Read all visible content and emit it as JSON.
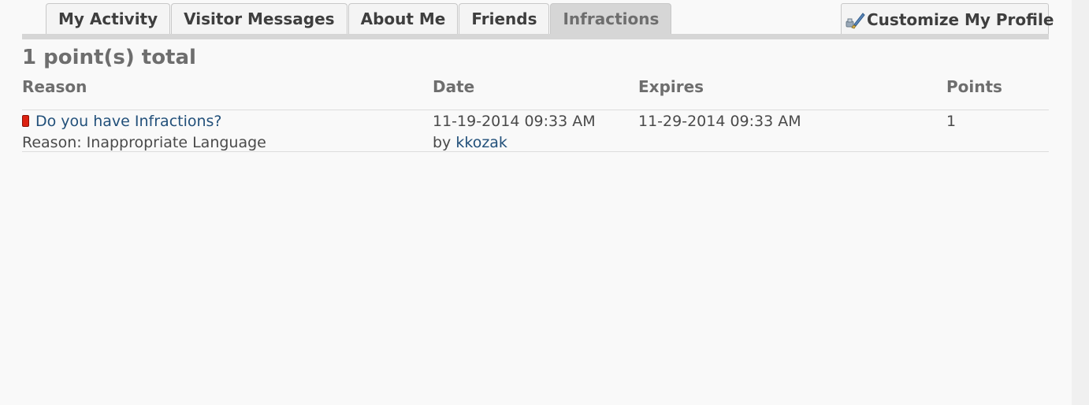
{
  "tabs": [
    {
      "label": "My Activity"
    },
    {
      "label": "Visitor Messages"
    },
    {
      "label": "About Me"
    },
    {
      "label": "Friends"
    },
    {
      "label": "Infractions",
      "active": true
    }
  ],
  "customize": {
    "label": "Customize My Profile",
    "icon": "paint-brush-icon"
  },
  "total_label": "1 point(s) total",
  "table": {
    "headers": {
      "reason": "Reason",
      "date": "Date",
      "expires": "Expires",
      "points": "Points"
    },
    "rows": [
      {
        "title": "Do you have Infractions?",
        "reason": "Reason: Inappropriate Language",
        "date": "11-19-2014 09:33 AM",
        "by_prefix": "by",
        "by_user": "kkozak",
        "expires": "11-29-2014 09:33 AM",
        "points": "1",
        "status_color": "#dd2211"
      }
    ]
  }
}
